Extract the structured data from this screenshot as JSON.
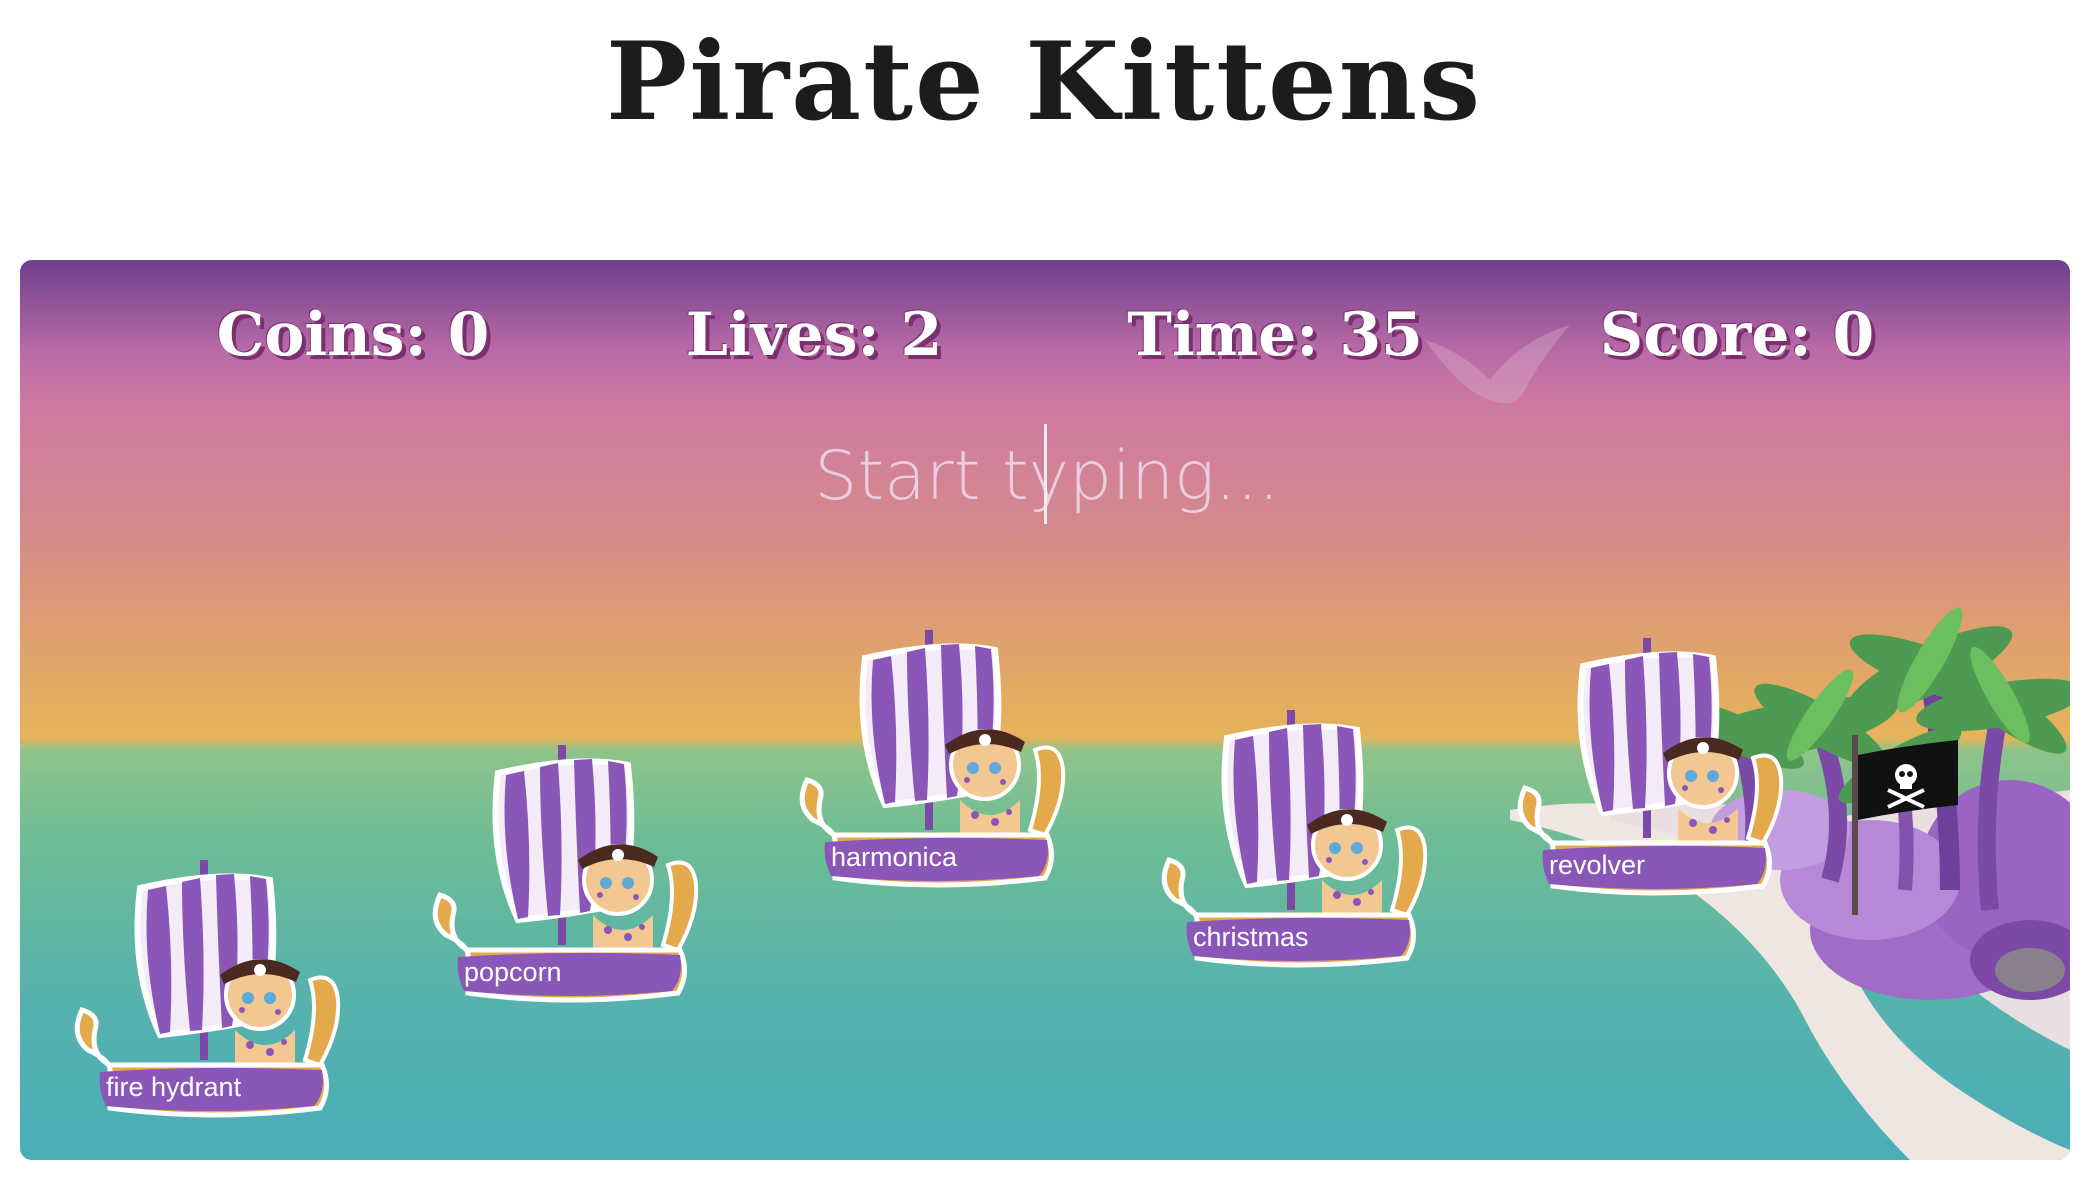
{
  "page": {
    "title": "Pirate Kittens"
  },
  "hud": {
    "coins": "Coins: 0",
    "lives": "Lives: 2",
    "time": "Time: 35",
    "score": "Score: 0"
  },
  "input": {
    "placeholder": "Start typing..."
  },
  "ships": [
    {
      "word": "fire hydrant"
    },
    {
      "word": "popcorn"
    },
    {
      "word": "harmonica"
    },
    {
      "word": "christmas"
    },
    {
      "word": "revolver"
    }
  ],
  "icons": {
    "flag": "skull-crossbones-flag-icon",
    "bird": "seagull-icon"
  },
  "colors": {
    "sail_purple": "#8a56b8",
    "sail_white": "#f3ecf8",
    "hull_gold": "#e3a94a",
    "hull_purple": "#8a56b8",
    "hud_shadow": "#7b2f6e",
    "sea": "#56b2ad",
    "sky_top": "#6e3f8c"
  }
}
